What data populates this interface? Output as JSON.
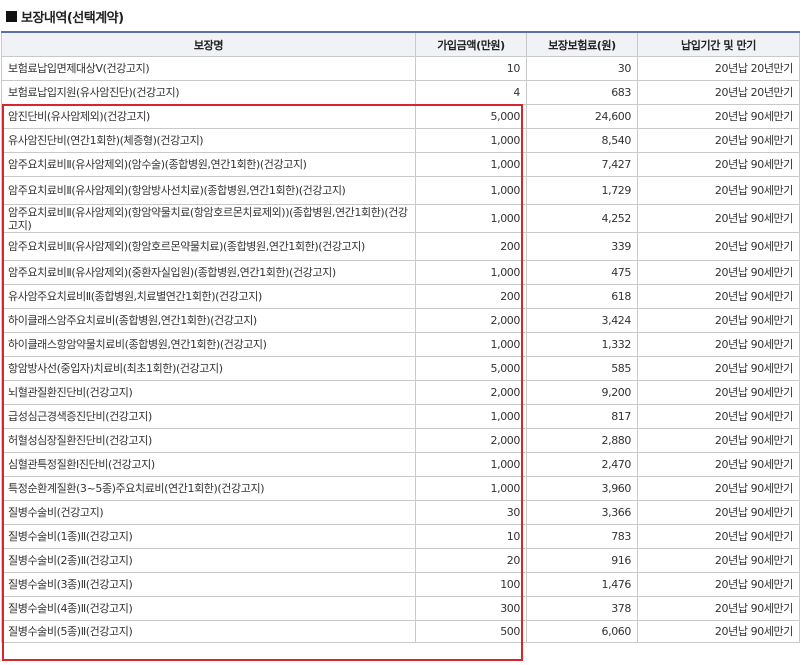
{
  "section_title": "보장내역(선택계약)",
  "columns": [
    "보장명",
    "가입금액(만원)",
    "보장보험료(원)",
    "납입기간 및 만기"
  ],
  "rows": [
    {
      "name": "보험료납입면제대상Ⅴ(건강고지)",
      "amount": "10",
      "premium": "30",
      "period": "20년납 20년만기"
    },
    {
      "name": "보험료납입지원(유사암진단)(건강고지)",
      "amount": "4",
      "premium": "683",
      "period": "20년납 20년만기"
    },
    {
      "name": "암진단비(유사암제외)(건강고지)",
      "amount": "5,000",
      "premium": "24,600",
      "period": "20년납 90세만기"
    },
    {
      "name": "유사암진단비(연간1회한)(체증형)(건강고지)",
      "amount": "1,000",
      "premium": "8,540",
      "period": "20년납 90세만기"
    },
    {
      "name": "암주요치료비Ⅱ(유사암제외)(암수술)(종합병원,연간1회한)(건강고지)",
      "amount": "1,000",
      "premium": "7,427",
      "period": "20년납 90세만기"
    },
    {
      "name": "암주요치료비Ⅱ(유사암제외)(항암방사선치료)(종합병원,연간1회한)(건강고지)",
      "amount": "1,000",
      "premium": "1,729",
      "period": "20년납 90세만기"
    },
    {
      "name": "암주요치료비Ⅱ(유사암제외)(항암약물치료(항암호르몬치료제외))(종합병원,연간1회한)(건강고지)",
      "amount": "1,000",
      "premium": "4,252",
      "period": "20년납 90세만기"
    },
    {
      "name": "암주요치료비Ⅱ(유사암제외)(항암호르몬약물치료)(종합병원,연간1회한)(건강고지)",
      "amount": "200",
      "premium": "339",
      "period": "20년납 90세만기"
    },
    {
      "name": "암주요치료비Ⅱ(유사암제외)(중환자실입원)(종합병원,연간1회한)(건강고지)",
      "amount": "1,000",
      "premium": "475",
      "period": "20년납 90세만기"
    },
    {
      "name": "유사암주요치료비Ⅱ(종합병원,치료별연간1회한)(건강고지)",
      "amount": "200",
      "premium": "618",
      "period": "20년납 90세만기"
    },
    {
      "name": "하이클래스암주요치료비(종합병원,연간1회한)(건강고지)",
      "amount": "2,000",
      "premium": "3,424",
      "period": "20년납 90세만기"
    },
    {
      "name": "하이클래스항암약물치료비(종합병원,연간1회한)(건강고지)",
      "amount": "1,000",
      "premium": "1,332",
      "period": "20년납 90세만기"
    },
    {
      "name": "항암방사선(중입자)치료비(최초1회한)(건강고지)",
      "amount": "5,000",
      "premium": "585",
      "period": "20년납 90세만기"
    },
    {
      "name": "뇌혈관질환진단비(건강고지)",
      "amount": "2,000",
      "premium": "9,200",
      "period": "20년납 90세만기"
    },
    {
      "name": "급성심근경색증진단비(건강고지)",
      "amount": "1,000",
      "premium": "817",
      "period": "20년납 90세만기"
    },
    {
      "name": "허혈성심장질환진단비(건강고지)",
      "amount": "2,000",
      "premium": "2,880",
      "period": "20년납 90세만기"
    },
    {
      "name": "심혈관특정질환Ⅰ진단비(건강고지)",
      "amount": "1,000",
      "premium": "2,470",
      "period": "20년납 90세만기"
    },
    {
      "name": "특정순환계질환(3~5종)주요치료비(연간1회한)(건강고지)",
      "amount": "1,000",
      "premium": "3,960",
      "period": "20년납 90세만기"
    },
    {
      "name": "질병수술비(건강고지)",
      "amount": "30",
      "premium": "3,366",
      "period": "20년납 90세만기"
    },
    {
      "name": "질병수술비(1종)Ⅱ(건강고지)",
      "amount": "10",
      "premium": "783",
      "period": "20년납 90세만기"
    },
    {
      "name": "질병수술비(2종)Ⅱ(건강고지)",
      "amount": "20",
      "premium": "916",
      "period": "20년납 90세만기"
    },
    {
      "name": "질병수술비(3종)Ⅱ(건강고지)",
      "amount": "100",
      "premium": "1,476",
      "period": "20년납 90세만기"
    },
    {
      "name": "질병수술비(4종)Ⅱ(건강고지)",
      "amount": "300",
      "premium": "378",
      "period": "20년납 90세만기"
    },
    {
      "name": "질병수술비(5종)Ⅱ(건강고지)",
      "amount": "500",
      "premium": "6,060",
      "period": "20년납 90세만기"
    }
  ],
  "colors": {
    "header_bg": "#f0f2f5",
    "header_line": "#5b6fa8",
    "highlight": "#d7262e",
    "border": "#c9c9c9"
  }
}
